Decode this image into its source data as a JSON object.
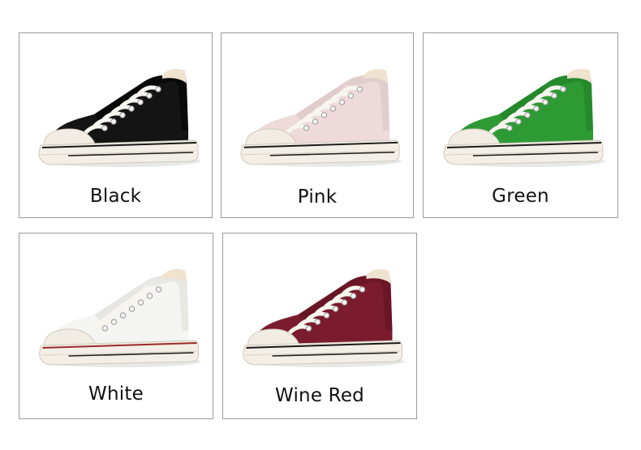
{
  "products": [
    {
      "label": "Black",
      "upper": "#141414",
      "shade": "#000000",
      "stripe": "#1a1a1a",
      "icon": "black-sneaker-icon"
    },
    {
      "label": "Pink",
      "upper": "#eedada",
      "shade": "#d9c2c3",
      "stripe": "#1a1a1a",
      "icon": "pink-sneaker-icon"
    },
    {
      "label": "Green",
      "upper": "#2e9a34",
      "shade": "#1f7d26",
      "stripe": "#1a1a1a",
      "icon": "green-sneaker-icon"
    },
    {
      "label": "White",
      "upper": "#f4f4f2",
      "shade": "#dcdcd8",
      "stripe": "#9b2a2a",
      "icon": "white-sneaker-icon"
    },
    {
      "label": "Wine Red",
      "upper": "#7a1c2e",
      "shade": "#5c1222",
      "stripe": "#1a1a1a",
      "icon": "wine-red-sneaker-icon"
    }
  ]
}
